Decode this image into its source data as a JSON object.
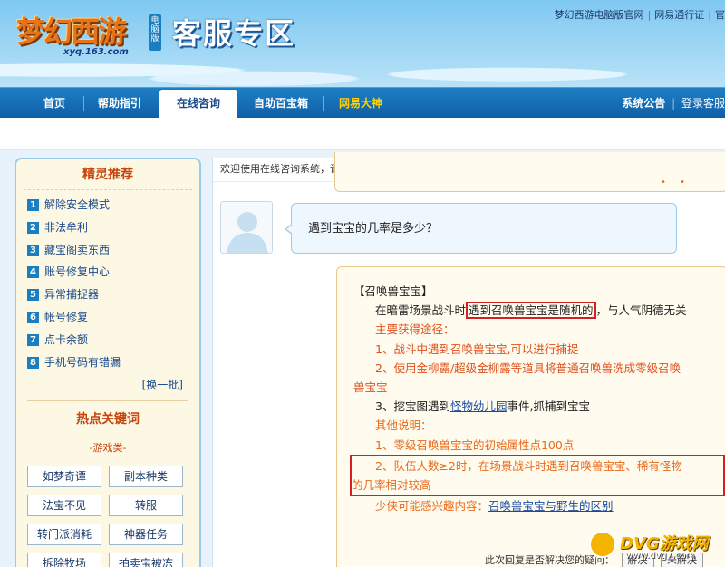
{
  "header": {
    "logo_text": "梦幻西游",
    "logo_badge": "电脑版",
    "logo_url": "xyq.163.com",
    "zone_title": "客服专区",
    "top_links": [
      "梦幻西游电脑版官网",
      "网易通行证",
      "官"
    ]
  },
  "nav": {
    "items": [
      {
        "label": "首页"
      },
      {
        "label": "帮助指引"
      },
      {
        "label": "在线咨询"
      },
      {
        "label": "自助百宝箱"
      },
      {
        "label": "网易大神"
      }
    ],
    "right": {
      "announce": "系统公告",
      "login": "登录客服"
    }
  },
  "sidebar": {
    "recommend_title": "精灵推荐",
    "recommend_items": [
      {
        "num": "1",
        "label": "解除安全模式"
      },
      {
        "num": "2",
        "label": "非法牟利"
      },
      {
        "num": "3",
        "label": "藏宝阁卖东西"
      },
      {
        "num": "4",
        "label": "账号修复中心"
      },
      {
        "num": "5",
        "label": "异常捕捉器"
      },
      {
        "num": "6",
        "label": "帐号修复"
      },
      {
        "num": "7",
        "label": "点卡余额"
      },
      {
        "num": "8",
        "label": "手机号码有错漏"
      }
    ],
    "refresh_label": "[换一批]",
    "hot_title": "热点关键词",
    "hot_category": "-游戏类-",
    "hot_keywords": [
      "如梦奇谭",
      "副本种类",
      "法宝不见",
      "转服",
      "转门派消耗",
      "神器任务",
      "拆除牧场",
      "拍卖宝被冻"
    ]
  },
  "main": {
    "welcome": "欢迎使用在线咨询系统，请您在下方输入提问内容。",
    "question": "遇到宝宝的几率是多少？",
    "answer": {
      "title": "【召唤兽宝宝】",
      "l1_pre": "在暗雷场景战斗时",
      "l1_box": "遇到召唤兽宝宝是随机的",
      "l1_post": "，与人气阴德无关",
      "l2": "主要获得途径：",
      "l3": "1、战斗中遇到召唤兽宝宝,可以进行捕捉",
      "l4": "2、使用金柳露/超级金柳露等道具将普通召唤兽洗成零级召唤",
      "l4b": "兽宝宝",
      "l5_pre": "3、挖宝图遇到",
      "l5_link": "怪物幼儿园",
      "l5_post": "事件,抓捕到宝宝",
      "l6": "其他说明：",
      "l7": "1、零级召唤兽宝宝的初始属性点100点",
      "l8": "2、队伍人数≥2时，在场景战斗时遇到召唤兽宝宝、稀有怪物",
      "l8b": "的几率相对较高",
      "l9_pre": "少侠可能感兴趣内容：",
      "l9_link": "召唤兽宝宝与野生的区别"
    },
    "feedback": {
      "prompt": "此次回复是否解决您的疑问：",
      "yes": "解决",
      "no": "未解决"
    }
  },
  "watermark": {
    "text": "DVG游戏网",
    "url": "www.dvg7.com"
  }
}
